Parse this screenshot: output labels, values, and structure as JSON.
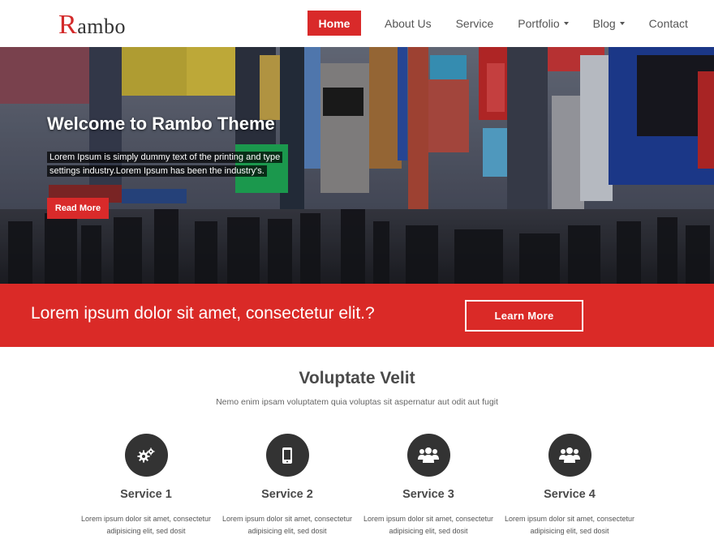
{
  "brand": {
    "logo_first": "R",
    "logo_rest": "ambo"
  },
  "nav": {
    "items": [
      {
        "label": "Home",
        "active": true,
        "dropdown": false
      },
      {
        "label": "About Us",
        "active": false,
        "dropdown": false
      },
      {
        "label": "Service",
        "active": false,
        "dropdown": false
      },
      {
        "label": "Portfolio",
        "active": false,
        "dropdown": true
      },
      {
        "label": "Blog",
        "active": false,
        "dropdown": true
      },
      {
        "label": "Contact",
        "active": false,
        "dropdown": false
      }
    ]
  },
  "hero": {
    "title": "Welcome to Rambo Theme",
    "text": "Lorem Ipsum is simply dummy text of the printing and type settings industry.Lorem Ipsum has been the industry's.",
    "button": "Read More"
  },
  "cta": {
    "text": "Lorem ipsum dolor sit amet, consectetur elit.?",
    "button": "Learn More"
  },
  "services": {
    "title": "Voluptate Velit",
    "subtitle": "Nemo enim ipsam voluptatem quia voluptas sit aspernatur aut odit aut fugit",
    "items": [
      {
        "icon": "gears-icon",
        "name": "Service 1",
        "desc": "Lorem ipsum dolor sit amet, consectetur adipisicing elit, sed dosit"
      },
      {
        "icon": "mobile-icon",
        "name": "Service 2",
        "desc": "Lorem ipsum dolor sit amet, consectetur adipisicing elit, sed dosit"
      },
      {
        "icon": "users-icon",
        "name": "Service 3",
        "desc": "Lorem ipsum dolor sit amet, consectetur adipisicing elit, sed dosit"
      },
      {
        "icon": "users-icon",
        "name": "Service 4",
        "desc": "Lorem ipsum dolor sit amet, consectetur adipisicing elit, sed dosit"
      }
    ]
  },
  "colors": {
    "accent": "#d92a2a",
    "icon_bg": "#333333"
  }
}
